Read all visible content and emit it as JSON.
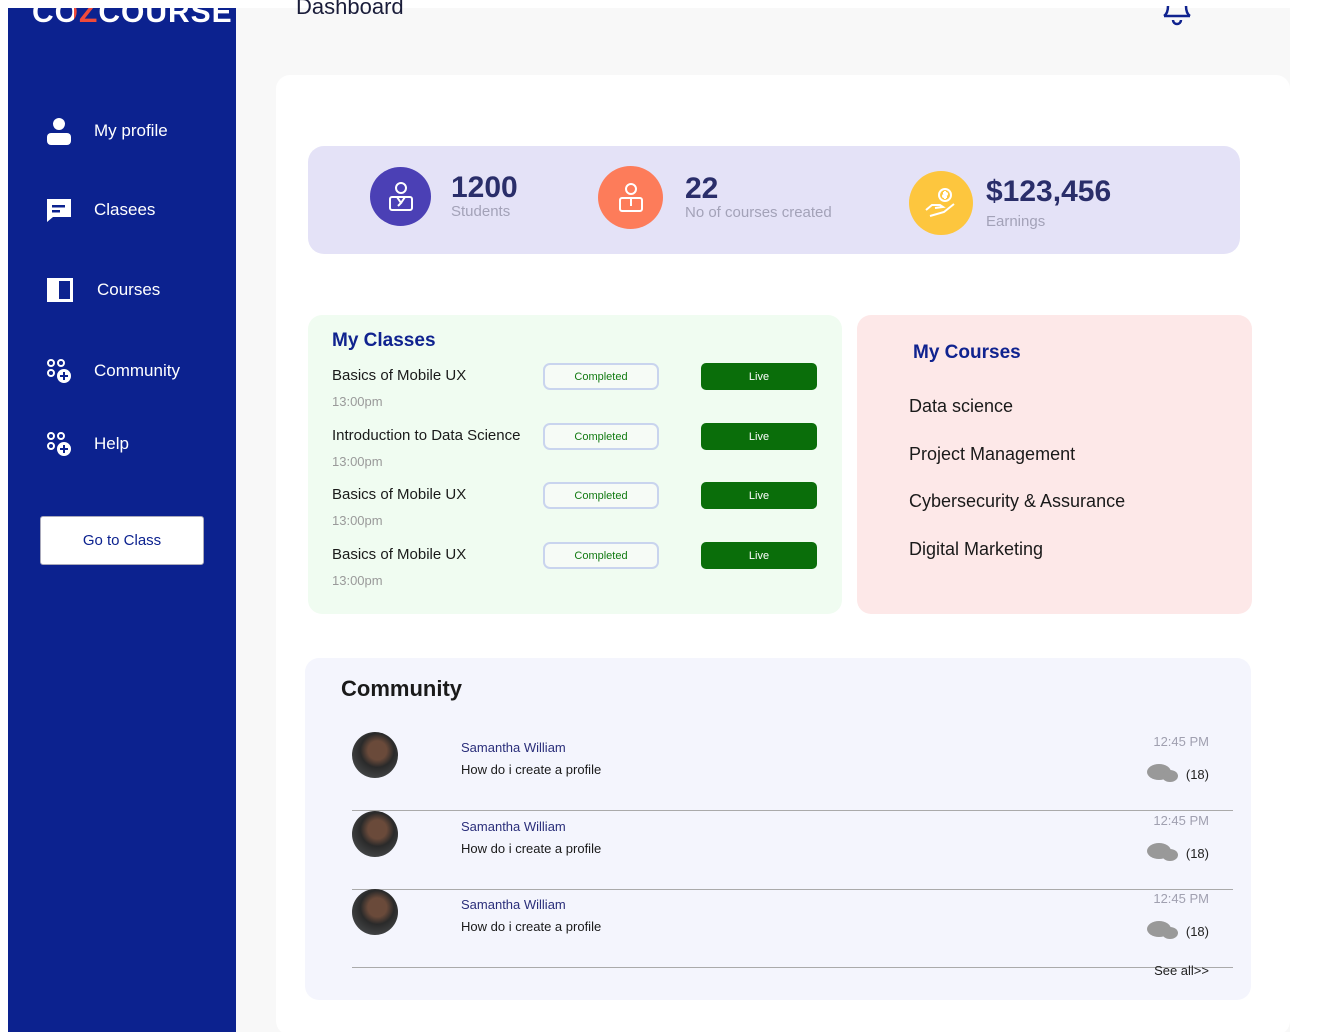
{
  "sidebar": {
    "logo_a": "COZ",
    "logo_z": "Z",
    "logo_b": "COURSE",
    "items": [
      {
        "label": "My profile"
      },
      {
        "label": "Clasees"
      },
      {
        "label": "Courses"
      },
      {
        "label": "Community"
      },
      {
        "label": "Help"
      }
    ],
    "go_class": "Go to Class"
  },
  "header": {
    "title": "Dashboard"
  },
  "stats": [
    {
      "value": "1200",
      "label": "Students",
      "color": "#4b40b5"
    },
    {
      "value": "22",
      "label": "No of courses created",
      "color": "#fd7c5a"
    },
    {
      "value": "$123,456",
      "label": "Earnings",
      "color": "#fdc63e"
    }
  ],
  "classes": {
    "title": "My Classes",
    "items": [
      {
        "name": "Basics of Mobile UX",
        "time": "13:00pm",
        "status": "Completed",
        "live": "Live"
      },
      {
        "name": "Introduction to Data Science",
        "time": "13:00pm",
        "status": "Completed",
        "live": "Live"
      },
      {
        "name": "Basics of Mobile UX",
        "time": "13:00pm",
        "status": "Completed",
        "live": "Live"
      },
      {
        "name": "Basics of Mobile UX",
        "time": "13:00pm",
        "status": "Completed",
        "live": "Live"
      }
    ]
  },
  "courses": {
    "title": "My Courses",
    "items": [
      "Data science",
      "Project  Management",
      "Cybersecurity & Assurance",
      "Digital Marketing"
    ]
  },
  "community": {
    "title": "Community",
    "posts": [
      {
        "name": "Samantha William",
        "text": "How do i create a  profile",
        "time": "12:45 PM",
        "count": "(18)"
      },
      {
        "name": "Samantha William",
        "text": "How do i create a  profile",
        "time": "12:45 PM",
        "count": "(18)"
      },
      {
        "name": "Samantha William",
        "text": "How do i create a  profile",
        "time": "12:45 PM",
        "count": "(18)"
      }
    ],
    "see_all": "See all>>"
  }
}
